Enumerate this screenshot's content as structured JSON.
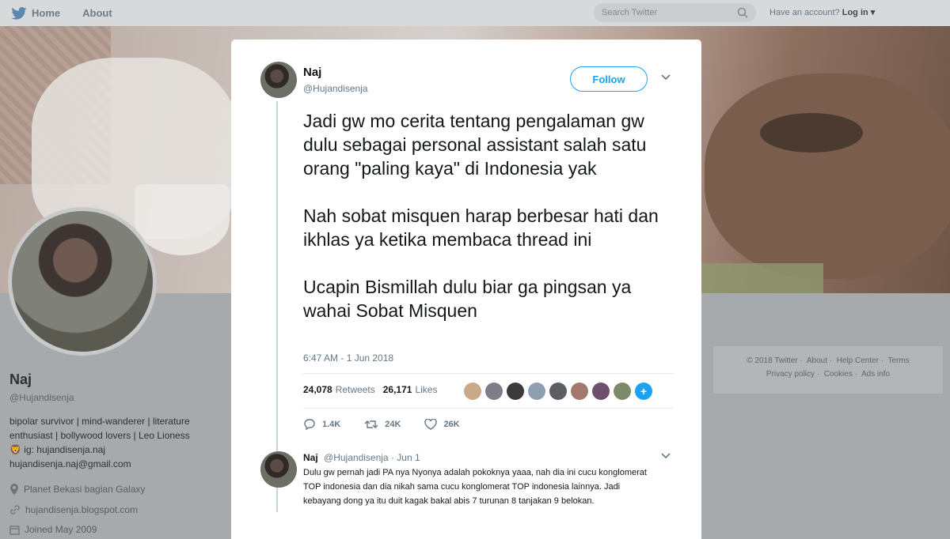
{
  "topbar": {
    "home_label": "Home",
    "about_label": "About",
    "search_placeholder": "Search Twitter",
    "account_prompt": "Have an account?",
    "login_label": "Log in"
  },
  "profile": {
    "name": "Naj",
    "handle": "@Hujandisenja",
    "bio_line1": "bipolar survivor | mind-wanderer | literature",
    "bio_line2": "enthusiast | bollywood lovers | Leo Lioness",
    "bio_line3": "ig: hujandisenja.naj",
    "bio_line4": "hujandisenja.naj@gmail.com",
    "location": "Planet Bekasi bagian Galaxy",
    "website": "hujandisenja.blogspot.com",
    "joined": "Joined May 2009"
  },
  "footer": {
    "line1": [
      "© 2018 Twitter",
      "About",
      "Help Center",
      "Terms"
    ],
    "line2": [
      "Privacy policy",
      "Cookies",
      "Ads info"
    ]
  },
  "tweet": {
    "author_name": "Naj",
    "author_handle": "@Hujandisenja",
    "follow_label": "Follow",
    "paragraph1": "Jadi gw mo cerita tentang pengalaman gw dulu sebagai personal assistant salah satu orang \"paling kaya\" di Indonesia yak",
    "paragraph2": "Nah sobat misquen harap berbesar hati dan ikhlas ya ketika membaca thread ini",
    "paragraph3": "Ucapin Bismillah dulu biar ga pingsan ya wahai Sobat Misquen",
    "timestamp": "6:47 AM - 1 Jun 2018",
    "retweets_count": "24,078",
    "retweets_label": "Retweets",
    "likes_count": "26,171",
    "likes_label": "Likes",
    "reply_count": "1.4K",
    "retweet_count_short": "24K",
    "like_count_short": "26K"
  },
  "reply": {
    "author_name": "Naj",
    "author_handle": "@Hujandisenja",
    "date": "· Jun 1",
    "text": "Dulu gw pernah jadi PA nya Nyonya adalah pokoknya yaaa, nah dia ini cucu konglomerat TOP indonesia dan dia nikah sama cucu konglomerat TOP indonesia lainnya. Jadi kebayang dong ya itu duit kagak bakal abis 7 turunan 8 tanjakan 9 belokan."
  },
  "colors": {
    "accent": "#1da1f2",
    "liker_avatars": [
      "#c9a98a",
      "#7c7f86",
      "#3b3b3b",
      "#8f9fb0",
      "#5b5e62",
      "#a2786c",
      "#6f4f6f",
      "#7c8a6a"
    ]
  }
}
